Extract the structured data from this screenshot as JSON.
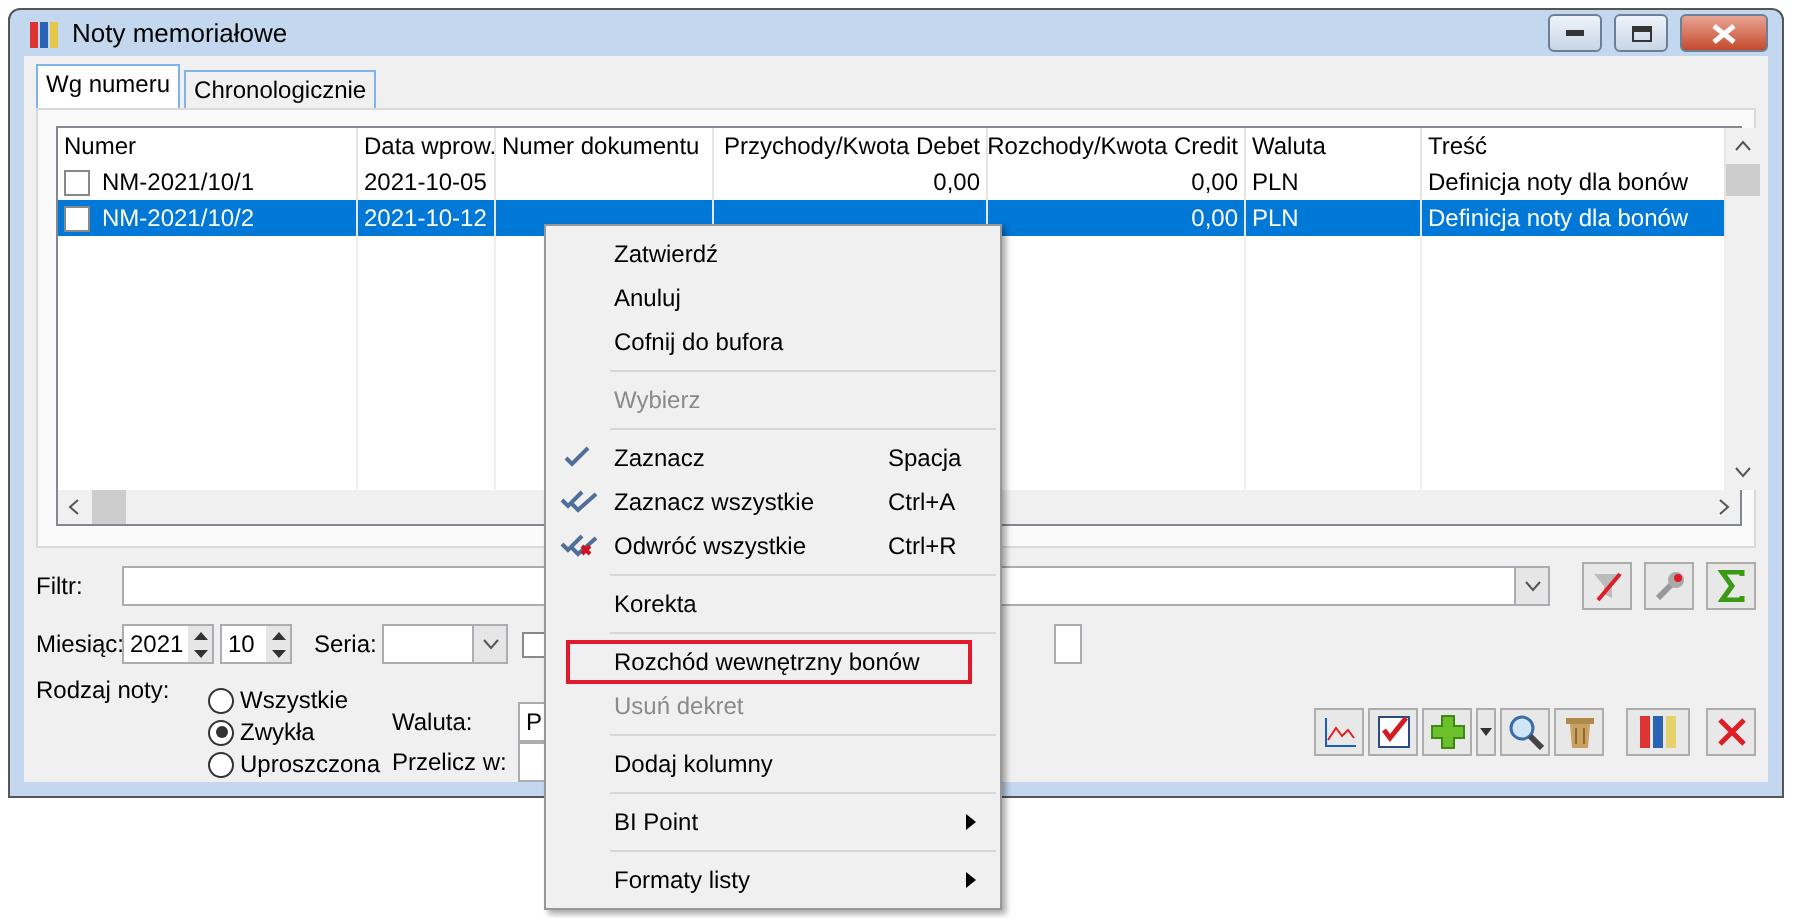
{
  "window": {
    "title": "Noty memoriałowe"
  },
  "tabs": [
    {
      "label": "Wg numeru",
      "selected": true
    },
    {
      "label": "Chronologicznie",
      "selected": false
    }
  ],
  "table": {
    "columns": [
      "Numer",
      "Data wprow.",
      "Numer dokumentu",
      "Przychody/Kwota Debet",
      "Rozchody/Kwota Credit",
      "Waluta",
      "Treść"
    ],
    "rows": [
      {
        "checked": false,
        "selected": false,
        "cells": [
          "NM-2021/10/1",
          "2021-10-05",
          null,
          "0,00",
          "0,00",
          "PLN",
          "Definicja noty dla bonów"
        ]
      },
      {
        "checked": false,
        "selected": true,
        "cells": [
          "NM-2021/10/2",
          "2021-10-12",
          null,
          null,
          "0,00",
          "PLN",
          "Definicja noty dla bonów"
        ]
      }
    ]
  },
  "filter": {
    "label": "Filtr:"
  },
  "month": {
    "label": "Miesiąc:",
    "year": "2021",
    "month": "10"
  },
  "series": {
    "label": "Seria:",
    "checked": false
  },
  "note_type": {
    "label": "Rodzaj noty:",
    "options": [
      {
        "label": "Wszystkie",
        "selected": false
      },
      {
        "label": "Zwykła",
        "selected": true
      },
      {
        "label": "Uproszczona",
        "selected": false
      }
    ]
  },
  "currency": {
    "label": "Waluta:",
    "value": "P"
  },
  "convert": {
    "label": "Przelicz w:"
  },
  "context_menu": [
    {
      "kind": "command",
      "label": "Zatwierdź",
      "disabled": false,
      "highlighted": false
    },
    {
      "kind": "command",
      "label": "Anuluj",
      "disabled": false,
      "highlighted": false
    },
    {
      "kind": "command",
      "label": "Cofnij do bufora",
      "disabled": false,
      "highlighted": false
    },
    {
      "kind": "separator"
    },
    {
      "kind": "command",
      "label": "Wybierz",
      "disabled": true,
      "highlighted": false
    },
    {
      "kind": "separator"
    },
    {
      "kind": "check",
      "label": "Zaznacz",
      "shortcut": "Spacja",
      "disabled": false,
      "highlighted": false
    },
    {
      "kind": "check_all",
      "label": "Zaznacz wszystkie",
      "shortcut": "Ctrl+A",
      "disabled": false,
      "highlighted": false
    },
    {
      "kind": "invert",
      "label": "Odwróć wszystkie",
      "shortcut": "Ctrl+R",
      "disabled": false,
      "highlighted": false
    },
    {
      "kind": "separator"
    },
    {
      "kind": "command",
      "label": "Korekta",
      "disabled": false,
      "highlighted": false
    },
    {
      "kind": "separator"
    },
    {
      "kind": "command",
      "label": "Rozchód wewnętrzny bonów",
      "disabled": false,
      "highlighted": true
    },
    {
      "kind": "command",
      "label": "Usuń dekret",
      "disabled": true,
      "highlighted": false
    },
    {
      "kind": "separator"
    },
    {
      "kind": "command",
      "label": "Dodaj kolumny",
      "disabled": false,
      "highlighted": false
    },
    {
      "kind": "separator"
    },
    {
      "kind": "submenu",
      "label": "BI Point",
      "disabled": false,
      "highlighted": false
    },
    {
      "kind": "separator"
    },
    {
      "kind": "submenu",
      "label": "Formaty listy",
      "disabled": false,
      "highlighted": false
    }
  ]
}
